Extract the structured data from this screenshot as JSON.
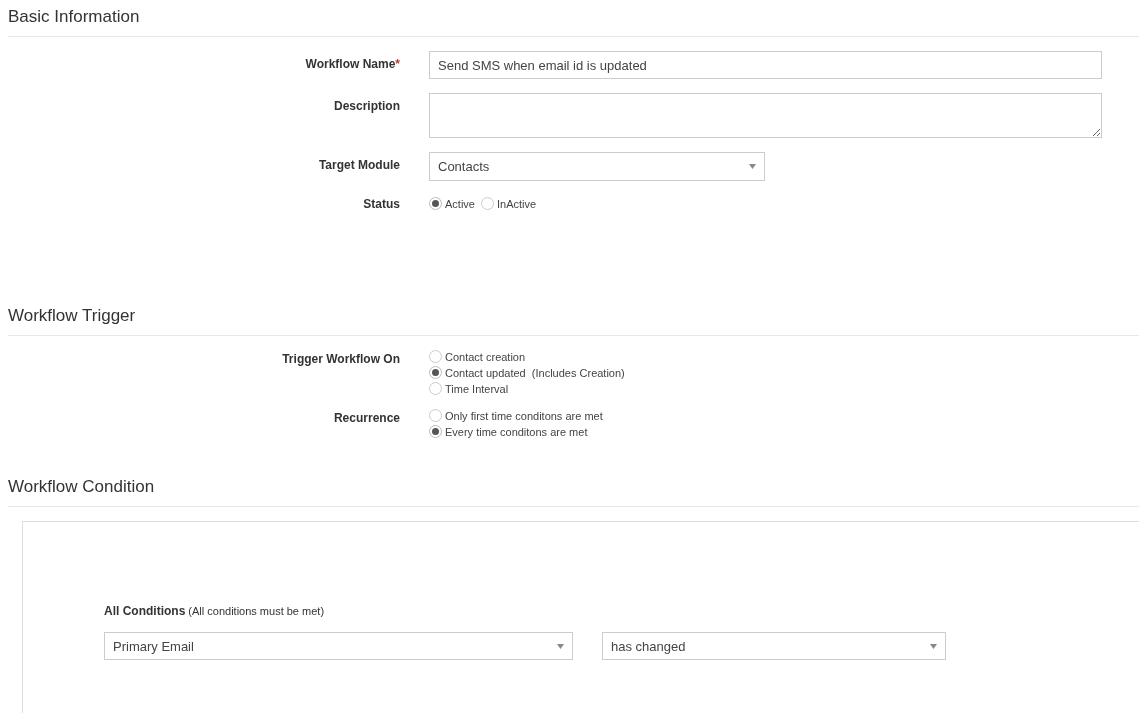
{
  "basic_information": {
    "title": "Basic Information",
    "fields": [
      {
        "kind": "text",
        "label": "Workflow Name",
        "required_mark": "*",
        "value": "Send SMS when email id is updated"
      },
      {
        "kind": "textarea",
        "label": "Description"
      },
      {
        "kind": "select",
        "label": "Target Module",
        "value": "Contacts"
      },
      {
        "kind": "radio_inline",
        "label": "Status",
        "options": [
          {
            "label": "Active",
            "selected": true
          },
          {
            "label": "InActive",
            "selected": false
          }
        ]
      }
    ]
  },
  "workflow_trigger": {
    "title": "Workflow Trigger",
    "fields": [
      {
        "kind": "radio_stack",
        "label": "Trigger Workflow On",
        "options": [
          {
            "label": "Contact creation",
            "selected": false
          },
          {
            "label": "Contact updated  (Includes Creation)",
            "selected": true
          },
          {
            "label": "Time Interval",
            "selected": false
          }
        ]
      },
      {
        "kind": "radio_stack",
        "label": "Recurrence",
        "options": [
          {
            "label": "Only first time conditons are met",
            "selected": false
          },
          {
            "label": "Every time conditons are met",
            "selected": true
          }
        ]
      }
    ]
  },
  "workflow_condition": {
    "title": "Workflow Condition",
    "group_title": "All Conditions",
    "group_note": "(All conditions must be met)",
    "selects": [
      "Primary Email",
      "has changed"
    ]
  }
}
